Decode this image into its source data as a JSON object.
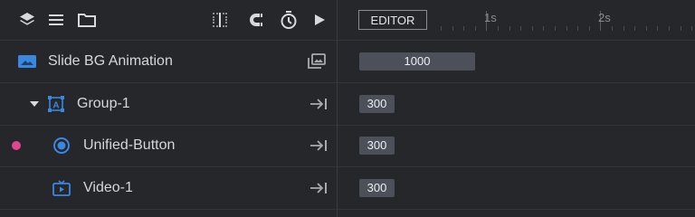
{
  "toolbar": {
    "icons": [
      "layers-icon",
      "list-icon",
      "folder-icon",
      "grid-toggle-icon",
      "magnet-icon",
      "stopwatch-icon",
      "play-icon"
    ]
  },
  "layers": [
    {
      "name": "Slide BG Animation",
      "icon": "image-icon",
      "end_icon": "gallery-icon",
      "timing": "1000"
    },
    {
      "name": "Group-1",
      "icon": "group-text-icon",
      "expanded": true,
      "end_icon": "arrow-to-end-icon",
      "timing": "300"
    },
    {
      "name": "Unified-Button",
      "icon": "radio-button-icon",
      "marked": true,
      "end_icon": "arrow-to-end-icon",
      "timing": "300"
    },
    {
      "name": "Video-1",
      "icon": "video-icon",
      "end_icon": "arrow-to-end-icon",
      "timing": "300"
    }
  ],
  "timeline": {
    "editor_label": "EDITOR",
    "ticks": [
      "1s",
      "2s"
    ]
  },
  "colors": {
    "background": "#26272b",
    "accent_blue": "#3b87e0",
    "marker_pink": "#e0468f",
    "bar": "#4b5059"
  }
}
